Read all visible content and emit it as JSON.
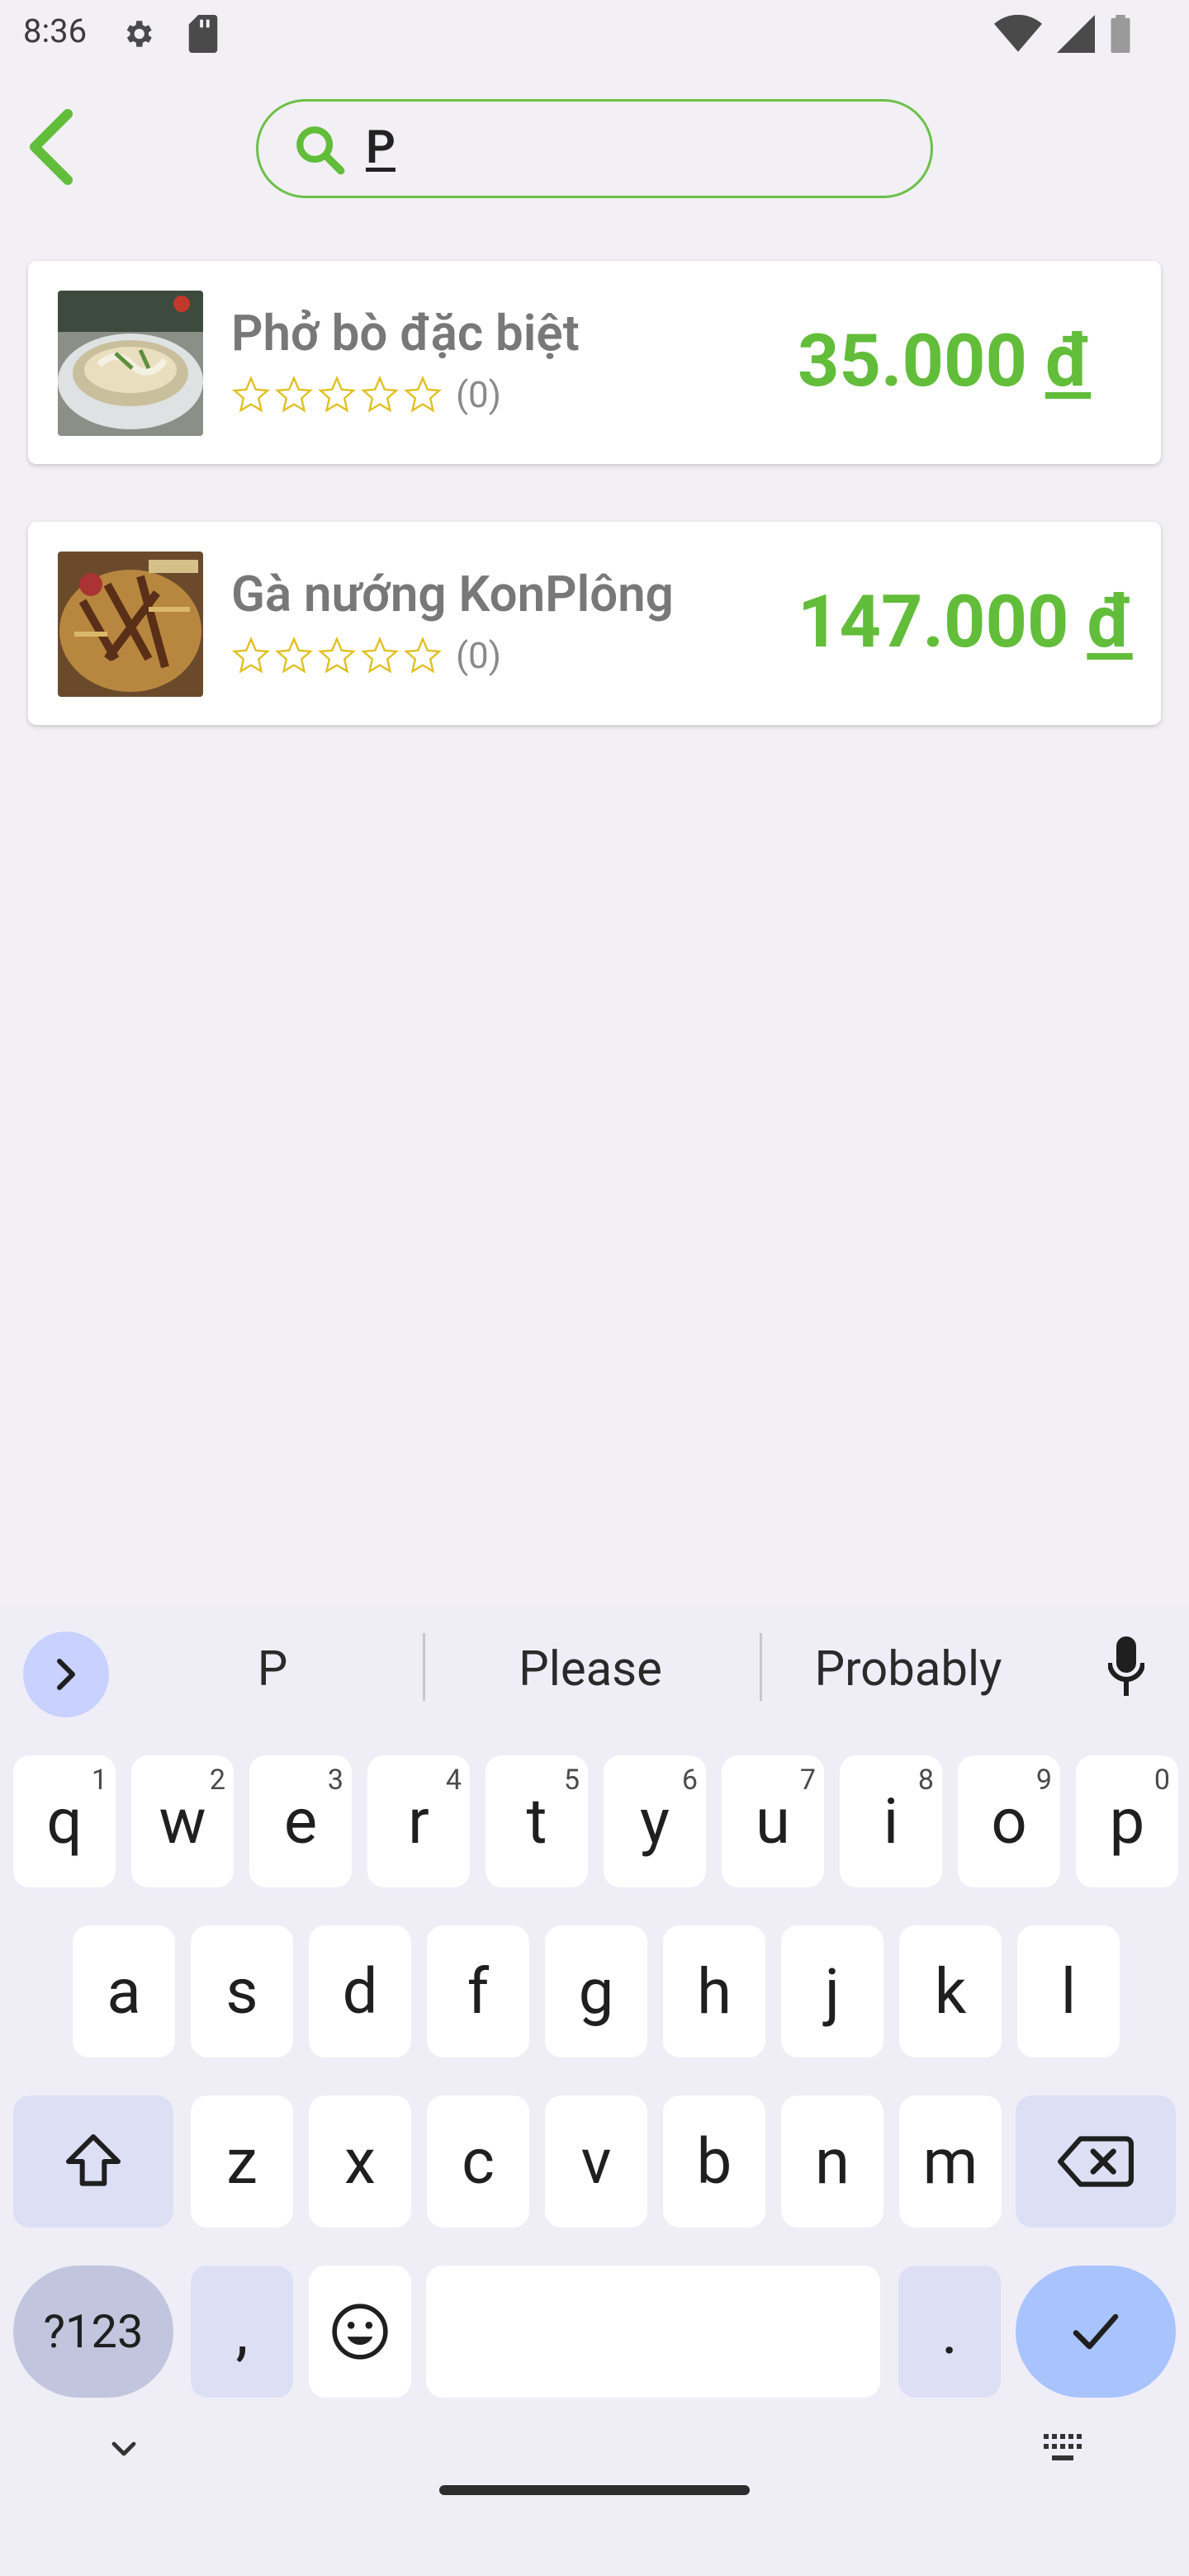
{
  "status_bar": {
    "time": "8:36",
    "icons": [
      "gear-icon",
      "sd-card-icon",
      "wifi-icon",
      "signal-icon",
      "battery-icon"
    ]
  },
  "search": {
    "query": "P",
    "icon": "search-icon",
    "accent_color": "#6cc04a"
  },
  "results": [
    {
      "name": "Phở bò đặc biệt",
      "rating_count": "(0)",
      "stars_filled": 0,
      "price_value": "35.000",
      "currency": "đ"
    },
    {
      "name": "Gà nướng KonPlông",
      "rating_count": "(0)",
      "stars_filled": 0,
      "price_value": "147.000",
      "currency": "đ"
    }
  ],
  "keyboard": {
    "suggestions": [
      "P",
      "Please",
      "Probably"
    ],
    "row1": [
      {
        "k": "q",
        "h": "1"
      },
      {
        "k": "w",
        "h": "2"
      },
      {
        "k": "e",
        "h": "3"
      },
      {
        "k": "r",
        "h": "4"
      },
      {
        "k": "t",
        "h": "5"
      },
      {
        "k": "y",
        "h": "6"
      },
      {
        "k": "u",
        "h": "7"
      },
      {
        "k": "i",
        "h": "8"
      },
      {
        "k": "o",
        "h": "9"
      },
      {
        "k": "p",
        "h": "0"
      }
    ],
    "row2": [
      "a",
      "s",
      "d",
      "f",
      "g",
      "h",
      "j",
      "k",
      "l"
    ],
    "row3": [
      "z",
      "x",
      "c",
      "v",
      "b",
      "n",
      "m"
    ],
    "sym_label": "?123",
    "comma_label": ",",
    "period_label": ".",
    "colors": {
      "special": "#dde0f5",
      "enter": "#a9c3ff"
    }
  }
}
